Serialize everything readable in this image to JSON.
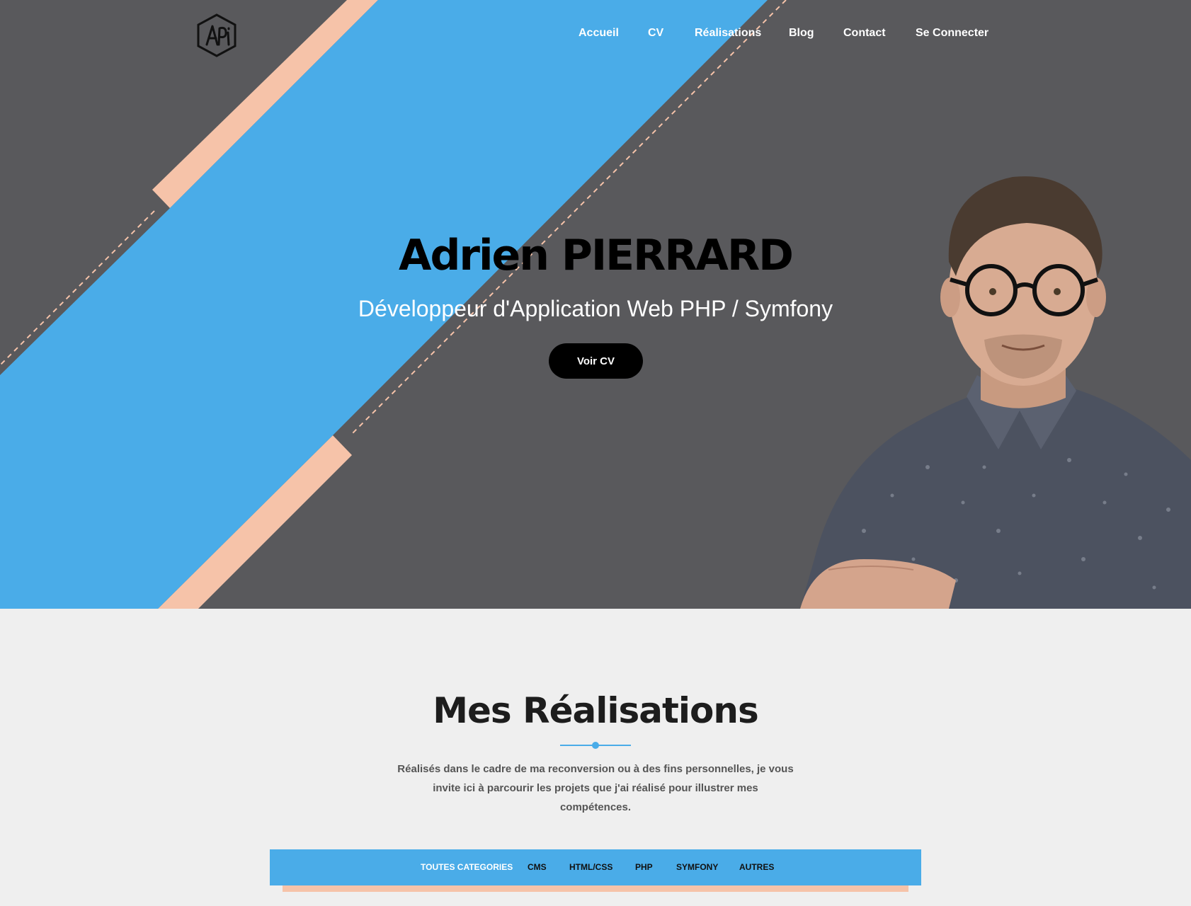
{
  "brand": {
    "logo_text": "APi"
  },
  "nav": {
    "items": [
      {
        "label": "Accueil"
      },
      {
        "label": "CV"
      },
      {
        "label": "Réalisations"
      },
      {
        "label": "Blog"
      },
      {
        "label": "Contact"
      },
      {
        "label": "Se Connecter"
      }
    ]
  },
  "hero": {
    "title": "Adrien PIERRARD",
    "subtitle": "Développeur d'Application Web PHP / Symfony",
    "cta_label": "Voir CV"
  },
  "realisations": {
    "title": "Mes Réalisations",
    "text": "Réalisés dans le cadre de ma reconversion ou à des fins personnelles, je vous invite ici à parcourir les projets que j'ai réalisé pour illustrer mes compétences.",
    "filters": [
      {
        "label": "TOUTES CATEGORIES",
        "active": true
      },
      {
        "label": "CMS",
        "active": false
      },
      {
        "label": "HTML/CSS",
        "active": false
      },
      {
        "label": "PHP",
        "active": false
      },
      {
        "label": "SYMFONY",
        "active": false
      },
      {
        "label": "AUTRES",
        "active": false
      }
    ]
  },
  "colors": {
    "accent_blue": "#4aace8",
    "accent_peach": "#f6c3a9",
    "hero_bg": "#59595c",
    "page_bg": "#efefef"
  }
}
